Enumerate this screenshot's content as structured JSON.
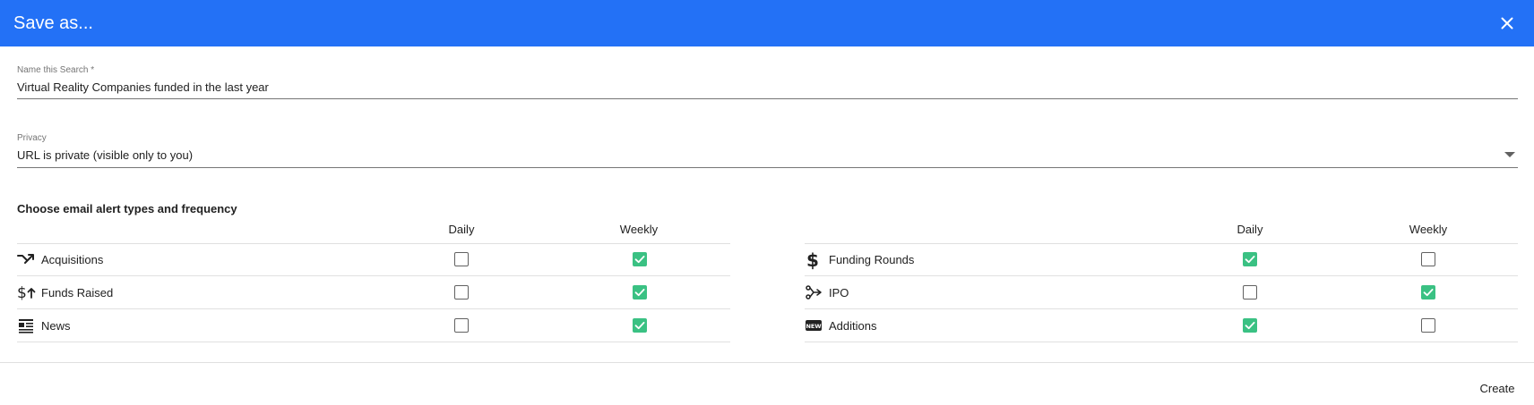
{
  "dialog": {
    "title": "Save as...",
    "close_icon": "close-icon",
    "header_color": "#2371f6"
  },
  "name_field": {
    "label": "Name this Search *",
    "value": "Virtual Reality Companies funded in the last year"
  },
  "privacy_field": {
    "label": "Privacy",
    "value": "URL is private (visible only to you)"
  },
  "alerts": {
    "heading": "Choose email alert types and frequency",
    "columns": [
      "Daily",
      "Weekly"
    ],
    "checked_color": "#3ac183",
    "left": [
      {
        "label": "Acquisitions",
        "icon": "acquisition-arrow-icon",
        "daily": false,
        "weekly": true
      },
      {
        "label": "Funds Raised",
        "icon": "dollar-up-icon",
        "daily": false,
        "weekly": true
      },
      {
        "label": "News",
        "icon": "newspaper-icon",
        "daily": false,
        "weekly": true
      }
    ],
    "right": [
      {
        "label": "Funding Rounds",
        "icon": "dollar-icon",
        "daily": true,
        "weekly": false
      },
      {
        "label": "IPO",
        "icon": "ipo-icon",
        "daily": false,
        "weekly": true
      },
      {
        "label": "Additions",
        "icon": "new-badge-icon",
        "daily": true,
        "weekly": false
      }
    ]
  },
  "footer": {
    "create_label": "Create"
  }
}
